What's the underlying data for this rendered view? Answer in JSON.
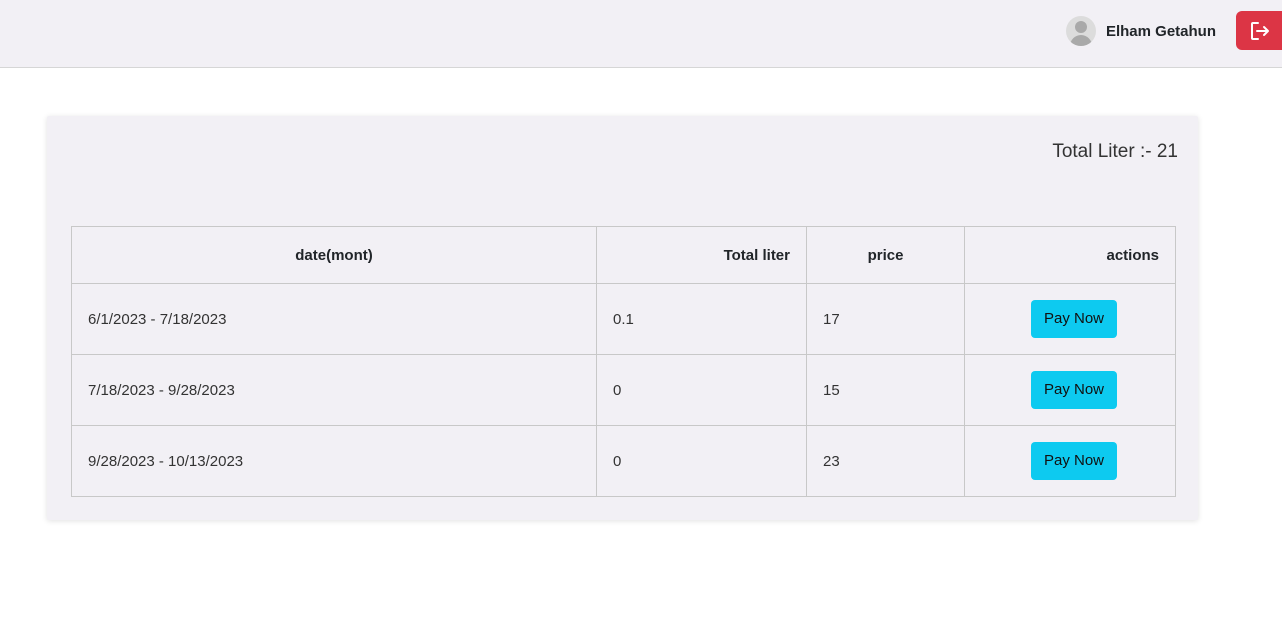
{
  "header": {
    "user_name": "Elham Getahun",
    "avatar_icon": "user-avatar-icon",
    "logout_icon": "logout-icon",
    "logout_color": "#dc3545"
  },
  "summary": {
    "total_liter_text": "Total Liter :- 21"
  },
  "table": {
    "headers": {
      "date": "date(mont)",
      "liter": "Total liter",
      "price": "price",
      "actions": "actions"
    },
    "rows": [
      {
        "date": "6/1/2023 - 7/18/2023",
        "liter": "0.1",
        "price": "17",
        "action": "Pay Now"
      },
      {
        "date": "7/18/2023 - 9/28/2023",
        "liter": "0",
        "price": "15",
        "action": "Pay Now"
      },
      {
        "date": "9/28/2023 - 10/13/2023",
        "liter": "0",
        "price": "23",
        "action": "Pay Now"
      }
    ]
  },
  "colors": {
    "pay_button": "#0dcaf0",
    "background_panel": "#f2f0f5"
  }
}
